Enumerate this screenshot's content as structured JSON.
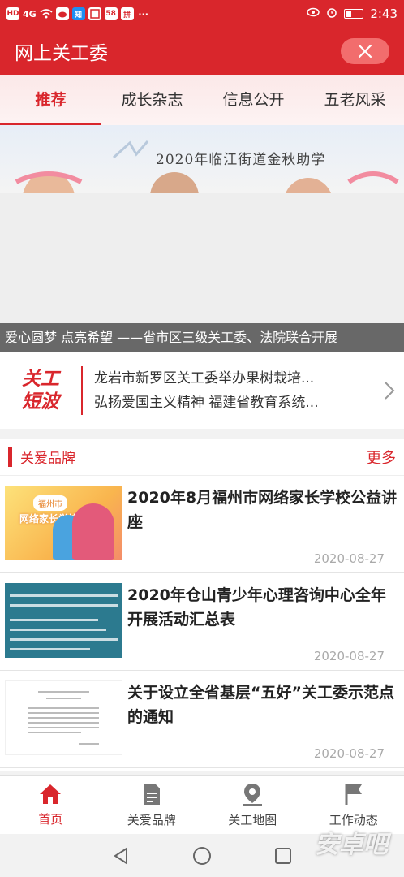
{
  "status_bar": {
    "left_icons": [
      "HD",
      "4G",
      "wifi",
      "weibo",
      "知",
      "58",
      "拼"
    ],
    "time": "2:43",
    "battery_level": 0.35
  },
  "appbar": {
    "title": "网上关工委"
  },
  "tabs": [
    {
      "label": "推荐",
      "active": true
    },
    {
      "label": "成长杂志",
      "active": false
    },
    {
      "label": "信息公开",
      "active": false
    },
    {
      "label": "五老风采",
      "active": false
    }
  ],
  "banner": {
    "image_title": "2020年临江街道金秋助学",
    "caption": "爱心圆梦 点亮希望 ——省市区三级关工委、法院联合开展"
  },
  "news_ticker": {
    "logo_line1": "关工",
    "logo_line2": "短波",
    "items": [
      "龙岩市新罗区关工委举办果树栽培...",
      "弘扬爱国主义精神 福建省教育系统..."
    ]
  },
  "section": {
    "title": "关爱品牌",
    "more": "更多",
    "articles": [
      {
        "title": "2020年8月福州市网络家长学校公益讲座",
        "date": "2020-08-27",
        "thumb_badge": "福州市",
        "thumb_text": "网络家长学校"
      },
      {
        "title": "2020年仓山青少年心理咨询中心全年开展活动汇总表",
        "date": "2020-08-27"
      },
      {
        "title": "关于设立全省基层“五好”关工委示范点的通知",
        "date": "2020-08-27"
      }
    ]
  },
  "bottom_nav": [
    {
      "label": "首页",
      "icon": "home-icon",
      "active": true
    },
    {
      "label": "关爱品牌",
      "icon": "document-icon",
      "active": false
    },
    {
      "label": "关工地图",
      "icon": "map-pin-icon",
      "active": false
    },
    {
      "label": "工作动态",
      "icon": "flag-icon",
      "active": false
    }
  ],
  "watermark": "安卓吧",
  "colors": {
    "brand": "#d9262c",
    "close_pill": "#f26d6d"
  }
}
